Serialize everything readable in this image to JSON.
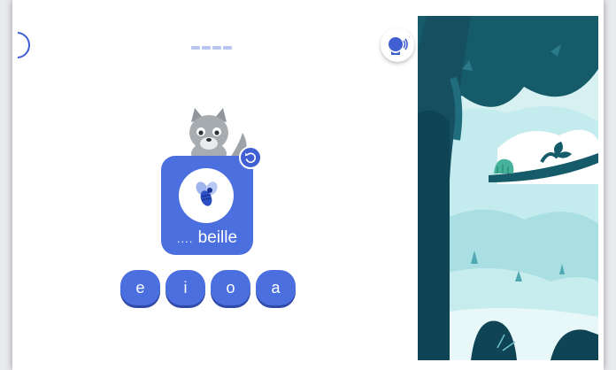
{
  "game": {
    "word": {
      "blank": "....",
      "suffix": "beille"
    },
    "choices": [
      "e",
      "i",
      "o",
      "a"
    ],
    "progress_segments": 4
  },
  "icons": {
    "audio": "speaking-head-icon",
    "replay": "replay-icon",
    "picture": "bee-icon",
    "mascot": "wolf-icon"
  },
  "colors": {
    "accent": "#4b6fde",
    "accent_dark": "#3f5fd3",
    "scene_dark": "#155b6a",
    "scene_light": "#cfeef0"
  }
}
